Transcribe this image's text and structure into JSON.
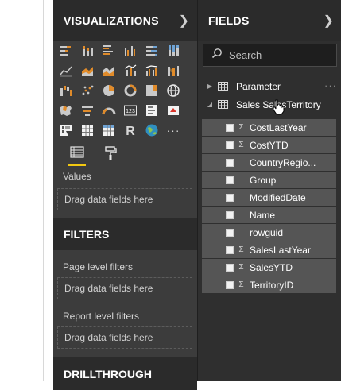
{
  "visualizations": {
    "title": "VISUALIZATIONS",
    "collapse_icon": "chevron-right-icon",
    "icons": [
      "stacked-bar-chart-icon",
      "stacked-column-chart-icon",
      "clustered-bar-chart-icon",
      "clustered-column-chart-icon",
      "100-stacked-bar-chart-icon",
      "100-stacked-column-chart-icon",
      "line-chart-icon",
      "area-chart-icon",
      "stacked-area-chart-icon",
      "line-and-stacked-column-icon",
      "line-and-clustered-column-icon",
      "ribbon-chart-icon",
      "waterfall-chart-icon",
      "scatter-chart-icon",
      "pie-chart-icon",
      "donut-chart-icon",
      "treemap-icon",
      "map-icon",
      "filled-map-icon",
      "funnel-icon",
      "gauge-icon",
      "card-icon",
      "multi-row-card-icon",
      "kpi-icon",
      "slicer-icon",
      "table-icon",
      "matrix-icon",
      "r-script-visual-icon",
      "globe-map-icon",
      "more-visuals-icon"
    ],
    "tools": [
      "fields-well-icon",
      "format-paint-roller-icon"
    ],
    "values_label": "Values",
    "dropzone_text": "Drag data fields here"
  },
  "filters": {
    "title": "FILTERS",
    "page_level": "Page level filters",
    "page_dropzone": "Drag data fields here",
    "report_level": "Report level filters",
    "report_dropzone": "Drag data fields here"
  },
  "drillthrough": {
    "title": "DRILLTHROUGH"
  },
  "fields": {
    "title": "FIELDS",
    "collapse_icon": "chevron-right-icon",
    "search_placeholder": "Search",
    "tables": [
      {
        "name": "Parameter",
        "expanded": false,
        "more": "···"
      },
      {
        "name": "Sales SalesTerritory",
        "expanded": true
      }
    ],
    "items": [
      {
        "name": "CostLastYear",
        "sigma": "Σ"
      },
      {
        "name": "CostYTD",
        "sigma": "Σ"
      },
      {
        "name": "CountryRegio...",
        "sigma": ""
      },
      {
        "name": "Group",
        "sigma": ""
      },
      {
        "name": "ModifiedDate",
        "sigma": ""
      },
      {
        "name": "Name",
        "sigma": ""
      },
      {
        "name": "rowguid",
        "sigma": ""
      },
      {
        "name": "SalesLastYear",
        "sigma": "Σ"
      },
      {
        "name": "SalesYTD",
        "sigma": "Σ"
      },
      {
        "name": "TerritoryID",
        "sigma": "Σ"
      }
    ]
  },
  "colors": {
    "accent": "#f2c811",
    "pane_dark": "#2b2b2b",
    "pane": "#3c3c3c",
    "field_row": "#555555"
  }
}
